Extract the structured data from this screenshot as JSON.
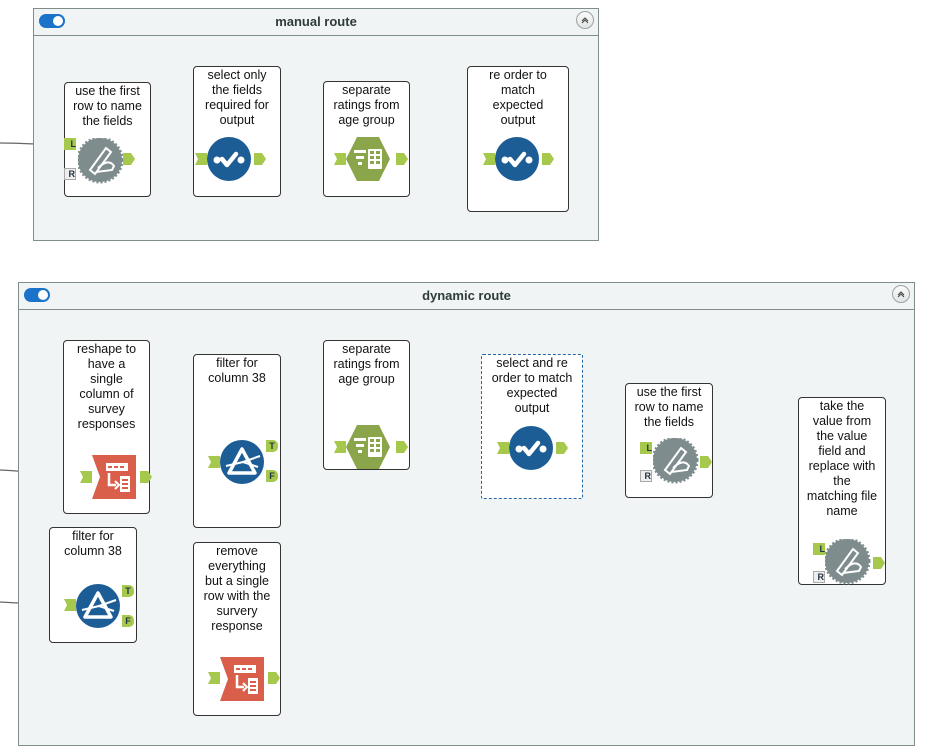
{
  "containers": [
    {
      "title": "manual route",
      "enabled": true,
      "tools": [
        {
          "label": "use the first\nrow to name\nthe fields",
          "icon": "dynamic-rename-icon"
        },
        {
          "label": "select only\nthe fields\nrequired for\noutput",
          "icon": "select-icon"
        },
        {
          "label": "separate\nratings from\nage group",
          "icon": "text-to-columns-icon"
        },
        {
          "label": "re order to\nmatch\nexpected\noutput",
          "icon": "select-icon"
        }
      ]
    },
    {
      "title": "dynamic route",
      "enabled": true,
      "tools": [
        {
          "label": "reshape to\nhave a\nsingle\ncolumn of\nsurvey\nresponses",
          "icon": "transpose-icon"
        },
        {
          "label": "filter for\ncolumn 38",
          "icon": "filter-icon"
        },
        {
          "label": "separate\nratings from\nage group",
          "icon": "text-to-columns-icon"
        },
        {
          "label": "select and re\norder to match\nexpected\noutput",
          "icon": "select-icon"
        },
        {
          "label": "use the first\nrow to name\nthe fields",
          "icon": "dynamic-rename-icon"
        },
        {
          "label": "take the\nvalue from\nthe value\nfield and\nreplace with\nthe\nmatching file\nname",
          "icon": "dynamic-rename-icon"
        },
        {
          "label": "filter for\ncolumn 38",
          "icon": "filter-icon"
        },
        {
          "label": "remove\neverything\nbut a single\nrow with the\nsurvery\nresponse",
          "icon": "transpose-icon"
        }
      ]
    }
  ],
  "anchors": {
    "left": "L",
    "right": "R",
    "true": "T",
    "false": "F"
  },
  "colors": {
    "anchor_green": "#a6c84c",
    "select_blue": "#1d5d96",
    "filter_blue": "#1d5d96",
    "parse_green": "#8aa54a",
    "transform_red": "#d95f4b",
    "rename_gray": "#7f8c8d",
    "toggle_blue": "#1a73c9"
  }
}
